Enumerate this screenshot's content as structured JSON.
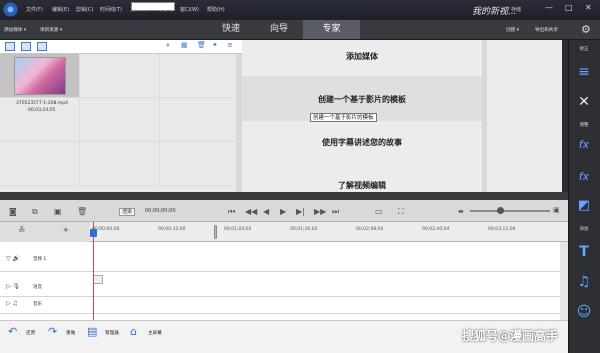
{
  "titlebar": {
    "menus": [
      "文件(F)",
      "编辑(E)",
      "剪辑(C)",
      "时间线(T)",
      "文本(X)",
      "工具(O)",
      "窗口(W)",
      "帮助(H)"
    ],
    "project_name": "我的新视...",
    "save_label": "存储",
    "window_buttons": [
      "—",
      "□",
      "✕"
    ]
  },
  "modebar": {
    "add_media": "添加媒体",
    "project_assets": "项目资源",
    "tabs": [
      "快速",
      "向导",
      "专家"
    ],
    "active_tab": "专家",
    "create": "创建",
    "export_share": "导出和共享"
  },
  "assets": {
    "search_placeholder": "",
    "clip_name": "370523577-1-208.mp4",
    "clip_time": "00;03;24;05"
  },
  "actions": {
    "items": [
      "添加媒体",
      "创建一个基于影片的模板",
      "使用字幕讲述您的故事",
      "了解视频编辑"
    ],
    "tooltip": "创建一个基于影片的模板"
  },
  "sidebar": {
    "labels": [
      "修正",
      "调整",
      "添加"
    ]
  },
  "timeline": {
    "render_label": "渲染",
    "timecode": "00;00;00;00",
    "ruler_marks": [
      "00;00;00;00",
      "00;00;32;00",
      "00;01;04;02",
      "00;01;36;02",
      "00;02;08;04",
      "00;02;40;04",
      "00;03;12;06"
    ],
    "tracks": [
      {
        "label": "音频 1"
      },
      {
        "label": "语音"
      },
      {
        "label": "音乐"
      }
    ]
  },
  "bottom": {
    "undo": "还原",
    "redo": "重做",
    "organizer": "管理器",
    "home": "主屏幕",
    "watermark": "搜狐号@漫画高手"
  },
  "colors": {
    "accent_blue": "#62a7ff",
    "playhead": "#e0453b"
  }
}
